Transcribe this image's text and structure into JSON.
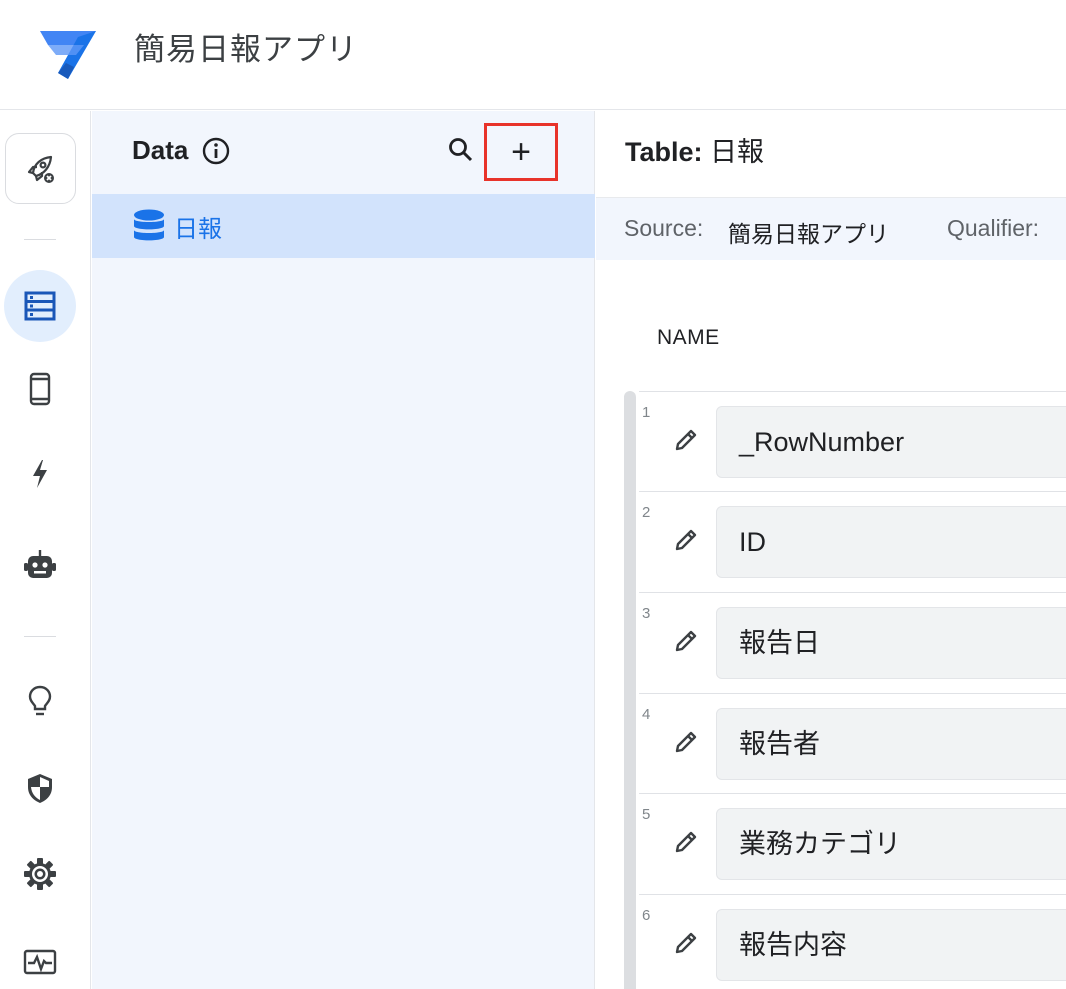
{
  "app": {
    "title": "簡易日報アプリ"
  },
  "rail": {
    "items": [
      "deploy-icon",
      "data-icon",
      "views-icon",
      "actions-icon",
      "bots-icon",
      "intelligence-icon",
      "security-icon",
      "settings-icon",
      "monitor-icon"
    ],
    "active": "data-icon"
  },
  "data_panel": {
    "title": "Data",
    "tables": [
      {
        "label": "日報",
        "icon": "database-icon"
      }
    ],
    "add_label": "+"
  },
  "main": {
    "table_prefix": "Table:",
    "table_name": "日報",
    "source_label": "Source:",
    "source_value": "簡易日報アプリ",
    "qualifier_label": "Qualifier:",
    "column_header": "NAME",
    "columns": [
      {
        "num": "1",
        "name": "_RowNumber"
      },
      {
        "num": "2",
        "name": "ID"
      },
      {
        "num": "3",
        "name": "報告日"
      },
      {
        "num": "4",
        "name": "報告者"
      },
      {
        "num": "5",
        "name": "業務カテゴリ"
      },
      {
        "num": "6",
        "name": "報告内容"
      }
    ]
  },
  "colors": {
    "accent": "#1a73e8",
    "highlight_border": "#e8332a",
    "selected_row": "#d2e3fc",
    "panel_bg": "#f2f6fd"
  }
}
